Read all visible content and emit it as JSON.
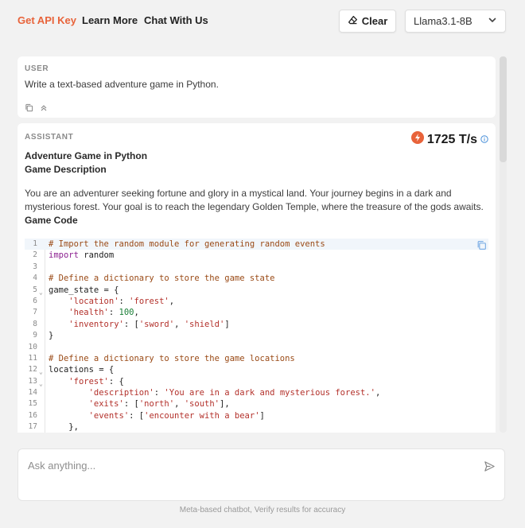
{
  "nav": {
    "api_key": "Get API Key",
    "learn_more": "Learn More",
    "chat_with_us": "Chat With Us"
  },
  "toolbar": {
    "clear_label": "Clear",
    "model_selected": "Llama3.1-8B"
  },
  "user_message": {
    "role": "USER",
    "text": "Write a text-based adventure game in Python."
  },
  "assistant_message": {
    "role": "ASSISTANT",
    "speed": "1725 T/s",
    "title": "Adventure Game in Python",
    "subtitle": "Game Description",
    "description": "You are an adventurer seeking fortune and glory in a mystical land. Your journey begins in a dark and mysterious forest. Your goal is to reach the legendary Golden Temple, where the treasure of the gods awaits.",
    "code_heading": "Game Code",
    "code_lines": [
      {
        "n": "1",
        "text": "# Import the random module for generating random events"
      },
      {
        "n": "2",
        "text": "import random"
      },
      {
        "n": "3",
        "text": ""
      },
      {
        "n": "4",
        "text": "# Define a dictionary to store the game state"
      },
      {
        "n": "5",
        "text": "game_state = {"
      },
      {
        "n": "6",
        "text": "    'location': 'forest',"
      },
      {
        "n": "7",
        "text": "    'health': 100,"
      },
      {
        "n": "8",
        "text": "    'inventory': ['sword', 'shield']"
      },
      {
        "n": "9",
        "text": "}"
      },
      {
        "n": "10",
        "text": ""
      },
      {
        "n": "11",
        "text": "# Define a dictionary to store the game locations"
      },
      {
        "n": "12",
        "text": "locations = {"
      },
      {
        "n": "13",
        "text": "    'forest': {"
      },
      {
        "n": "14",
        "text": "        'description': 'You are in a dark and mysterious forest.',"
      },
      {
        "n": "15",
        "text": "        'exits': ['north', 'south'],"
      },
      {
        "n": "16",
        "text": "        'events': ['encounter with a bear']"
      },
      {
        "n": "17",
        "text": "    },"
      }
    ]
  },
  "composer": {
    "placeholder": "Ask anything..."
  },
  "footer": "Meta-based chatbot, Verify results for accuracy",
  "colors": {
    "accent": "#e8633a",
    "keyword": "#8b1e8f",
    "string": "#b3312b",
    "comment": "#9a4a16",
    "number": "#1a7f37",
    "info_blue": "#4a90d9"
  },
  "icons": [
    "eraser-icon",
    "chevron-down-icon",
    "copy-icon",
    "collapse-icon",
    "lightning-icon",
    "info-icon",
    "send-icon"
  ]
}
